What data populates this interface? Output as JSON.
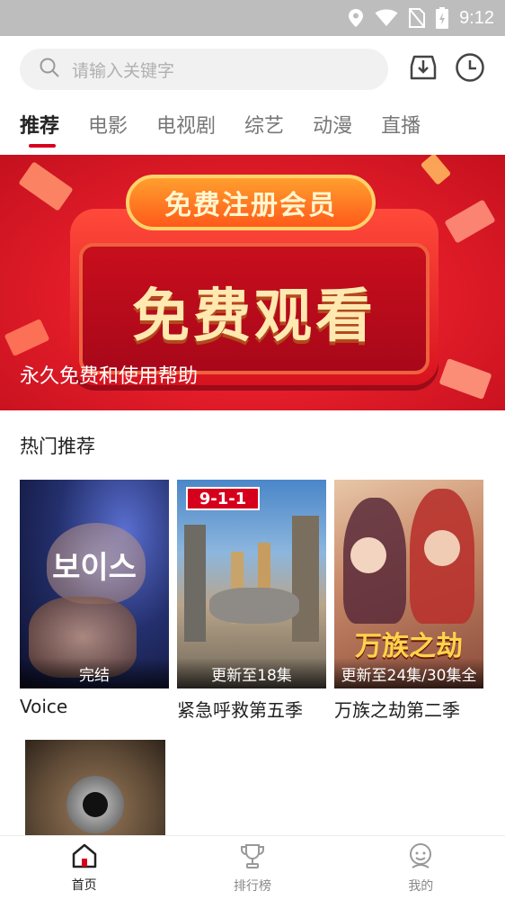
{
  "status_bar": {
    "time": "9:12"
  },
  "search": {
    "placeholder": "请输入关键字"
  },
  "tabs": [
    {
      "label": "推荐",
      "active": true
    },
    {
      "label": "电影"
    },
    {
      "label": "电视剧"
    },
    {
      "label": "综艺"
    },
    {
      "label": "动漫"
    },
    {
      "label": "直播"
    }
  ],
  "banner": {
    "pill_text": "免费注册会员",
    "headline": "免费观看",
    "caption": "永久免费和使用帮助"
  },
  "section": {
    "title": "热门推荐"
  },
  "cards": [
    {
      "title": "Voice",
      "badge": "完结",
      "poster_text": "보이스"
    },
    {
      "title": "紧急呼救第五季",
      "badge": "更新至18集",
      "poster_text": "9-1-1"
    },
    {
      "title": "万族之劫第二季",
      "badge": "更新至24集/30集全",
      "poster_text": "万族之劫"
    }
  ],
  "bottom_nav": [
    {
      "label": "首页",
      "icon": "home-icon",
      "active": true
    },
    {
      "label": "排行榜",
      "icon": "trophy-icon"
    },
    {
      "label": "我的",
      "icon": "profile-icon"
    }
  ],
  "colors": {
    "accent": "#d6001c",
    "status_bar": "#bdbdbd"
  }
}
